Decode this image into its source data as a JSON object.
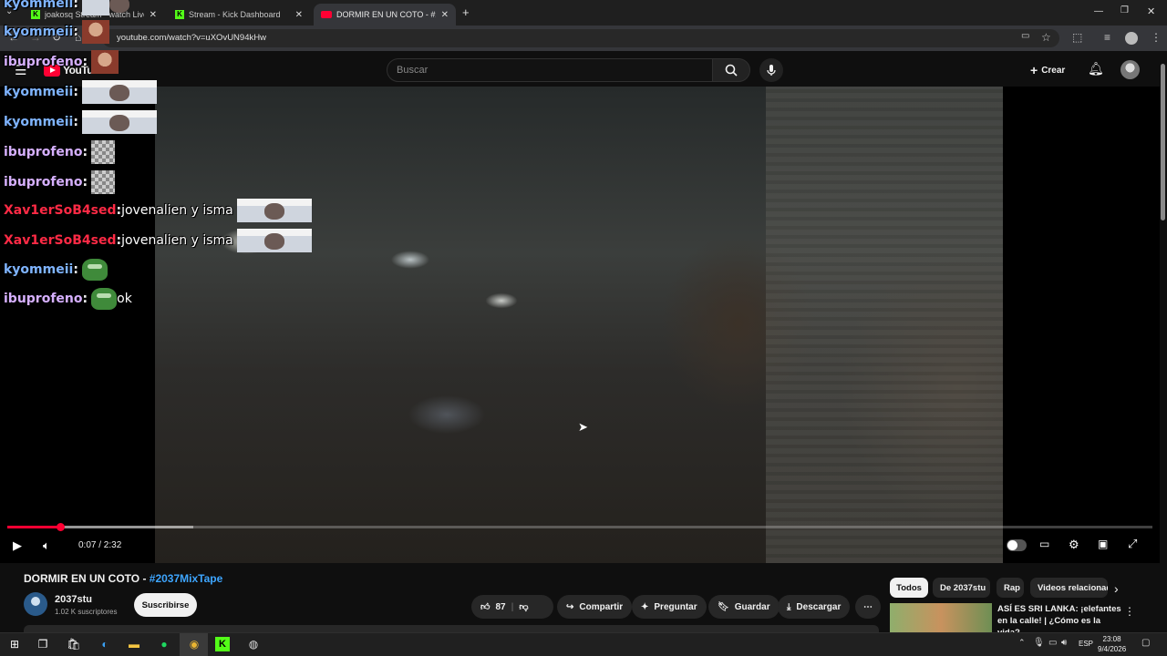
{
  "browser": {
    "tabs": [
      {
        "title": "joakosq Stream - watch Live on Kick",
        "active": false
      },
      {
        "title": "Stream - Kick Dashboard",
        "active": false
      },
      {
        "title": "DORMIR EN UN COTO - #2037MixTape",
        "active": true
      }
    ],
    "new_tab": "+",
    "url": "youtube.com/watch?v=uXOvUN94kHw"
  },
  "youtube": {
    "logo": "YouTube",
    "search_placeholder": "Buscar",
    "create_label": "Crear"
  },
  "player": {
    "time": "0:07 / 2:32",
    "progress_fraction": 0.046,
    "buffered_fraction": 0.16
  },
  "chat": [
    {
      "user": "kyommeii",
      "color": "#7fb4ff",
      "text": "",
      "emote": "face"
    },
    {
      "user": "ibuprofeno",
      "color": "#d6b0ff",
      "text": "",
      "emote": "avatar"
    },
    {
      "user": "kyommeii",
      "color": "#7fb4ff",
      "text": "",
      "emote": "face"
    },
    {
      "user": "kyommeii",
      "color": "#7fb4ff",
      "text": "",
      "emote": "face"
    },
    {
      "user": "ibuprofeno",
      "color": "#d6b0ff",
      "text": "",
      "emote": "check"
    },
    {
      "user": "ibuprofeno",
      "color": "#d6b0ff",
      "text": "",
      "emote": "check"
    },
    {
      "user": "Xav1erSoB4sed",
      "color": "#ff2a45",
      "text": " jovenalien y isma",
      "emote": "face"
    },
    {
      "user": "Xav1erSoB4sed",
      "color": "#ff2a45",
      "text": " jovenalien y isma",
      "emote": "face"
    },
    {
      "user": "kyommeii",
      "color": "#7fb4ff",
      "text": "",
      "emote": "pepe"
    },
    {
      "user": "ibuprofeno",
      "color": "#d6b0ff",
      "text": " ok",
      "emote": "pepe"
    }
  ],
  "video": {
    "title": "DORMIR EN UN COTO - ",
    "hashtag": "#2037MixTape",
    "channel": "2037stu",
    "subscribers": "1.02 K suscriptores",
    "subscribe_label": "Suscribirse",
    "likes": "87",
    "share_label": "Compartir",
    "ask_label": "Preguntar",
    "save_label": "Guardar",
    "download_label": "Descargar"
  },
  "related": {
    "chips": [
      "Todos",
      "De 2037stu",
      "Rap",
      "Videos relacionados"
    ],
    "first_title": "ASÍ ES SRI LANKA: ¡elefantes en la calle! | ¿Cómo es la vida?..."
  },
  "taskbar": {
    "lang": "ESP",
    "time": "23:08",
    "date": "9/4/2026"
  },
  "colors": {
    "accent_red": "#ff0033",
    "link_blue": "#3ea6ff",
    "kick_green": "#53fc18"
  }
}
